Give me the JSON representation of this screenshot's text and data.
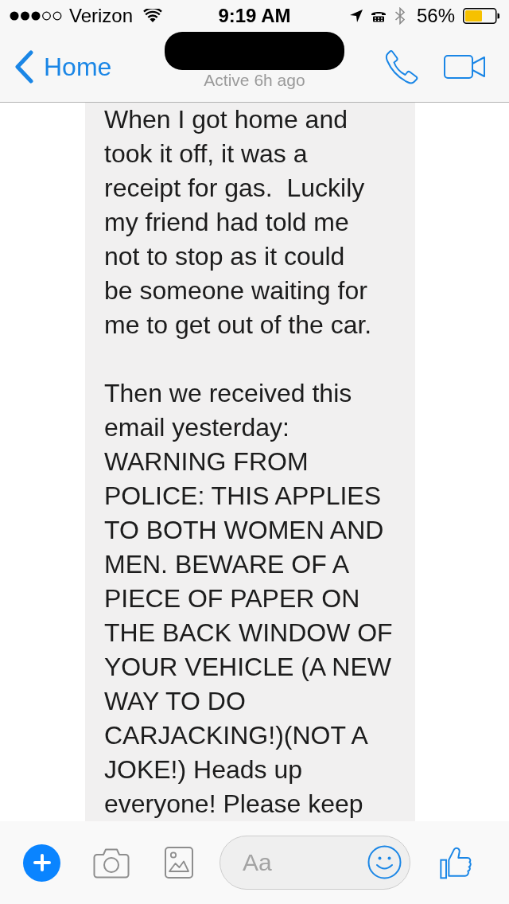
{
  "status_bar": {
    "carrier": "Verizon",
    "time": "9:19 AM",
    "battery": "56%"
  },
  "nav_bar": {
    "back_label": "Home",
    "subtitle": "Active 6h ago"
  },
  "message": {
    "paragraphs": [
      {
        "lines": [
          "When I got home and",
          "took it off, it was a",
          "receipt for gas.  Luckily",
          "my friend had told me",
          "not to stop as it could",
          "be someone waiting for",
          "me to get out of the car."
        ]
      },
      {
        "lines": [
          "Then we received this",
          "email yesterday:",
          "WARNING FROM",
          "POLICE: THIS APPLIES",
          "TO BOTH WOMEN AND",
          "MEN. BEWARE OF A",
          "PIECE OF PAPER ON",
          "THE BACK WINDOW OF",
          "YOUR VEHICLE (A NEW",
          "WAY TO DO",
          "CARJACKING!)(NOT A",
          "JOKE!) Heads up",
          "everyone! Please keep"
        ]
      }
    ]
  },
  "composer": {
    "placeholder": "Aa"
  }
}
